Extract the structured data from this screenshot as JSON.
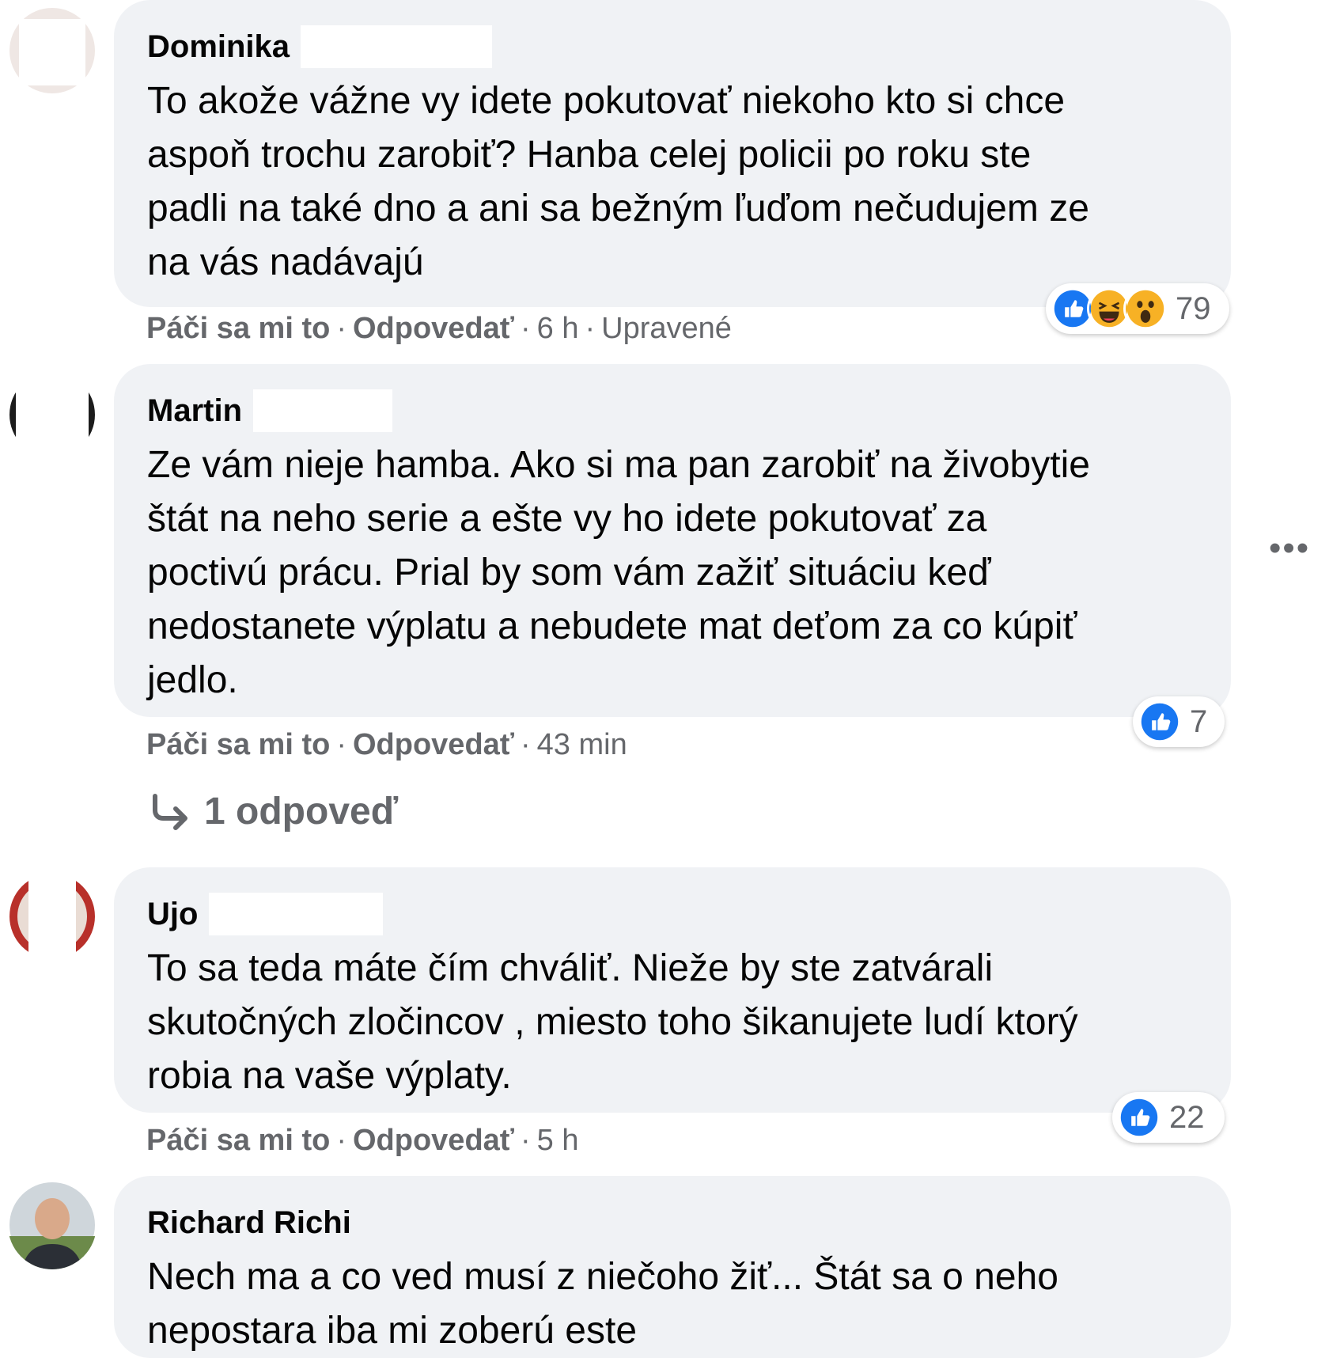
{
  "comments": [
    {
      "author": "Dominika",
      "text": "To akože vážne vy idete pokutovať niekoho kto si chce\naspoň trochu zarobiť? Hanba celej policii po roku ste\npadli na také dno a ani sa bežným ľuďom nečudujem ze\nna vás nadávajú",
      "like_label": "Páči sa mi to",
      "reply_label": "Odpovedať",
      "time": "6 h",
      "edited": "Upravené",
      "reaction_count": "79",
      "reaction_icons": [
        "like-icon",
        "haha-icon",
        "wow-icon"
      ]
    },
    {
      "author": "Martin",
      "text": "Ze vám nieje hamba. Ako si ma pan zarobiť na živobytie\nštát na neho serie a ešte vy ho idete pokutovať za\npoctivú prácu. Prial by som vám zažiť situáciu keď\nnedostanete výplatu a nebudete mat deťom za co kúpiť\njedlo.",
      "like_label": "Páči sa mi to",
      "reply_label": "Odpovedať",
      "time": "43 min",
      "reaction_count": "7",
      "reaction_icons": [
        "like-icon"
      ],
      "replies_label": "1 odpoveď"
    },
    {
      "author": "Ujo",
      "text": "To sa teda máte čím chváliť. Nieže by ste zatvárali\nskutočných zločincov , miesto toho šikanujete ludí ktorý\nrobia na vaše výplaty.",
      "like_label": "Páči sa mi to",
      "reply_label": "Odpovedať",
      "time": "5 h",
      "reaction_count": "22",
      "reaction_icons": [
        "like-icon"
      ]
    },
    {
      "author": "Richard Richi",
      "text": "Nech ma a co ved musí z niečoho žiť... Štát sa o neho\nnepostara iba mi zoberú este"
    }
  ],
  "more_label": "•••",
  "separator": "·",
  "colors": {
    "bubble": "#f0f2f5",
    "meta": "#65676b",
    "like_blue": "#1877f2",
    "emoji_yellow": "#f7b125"
  }
}
